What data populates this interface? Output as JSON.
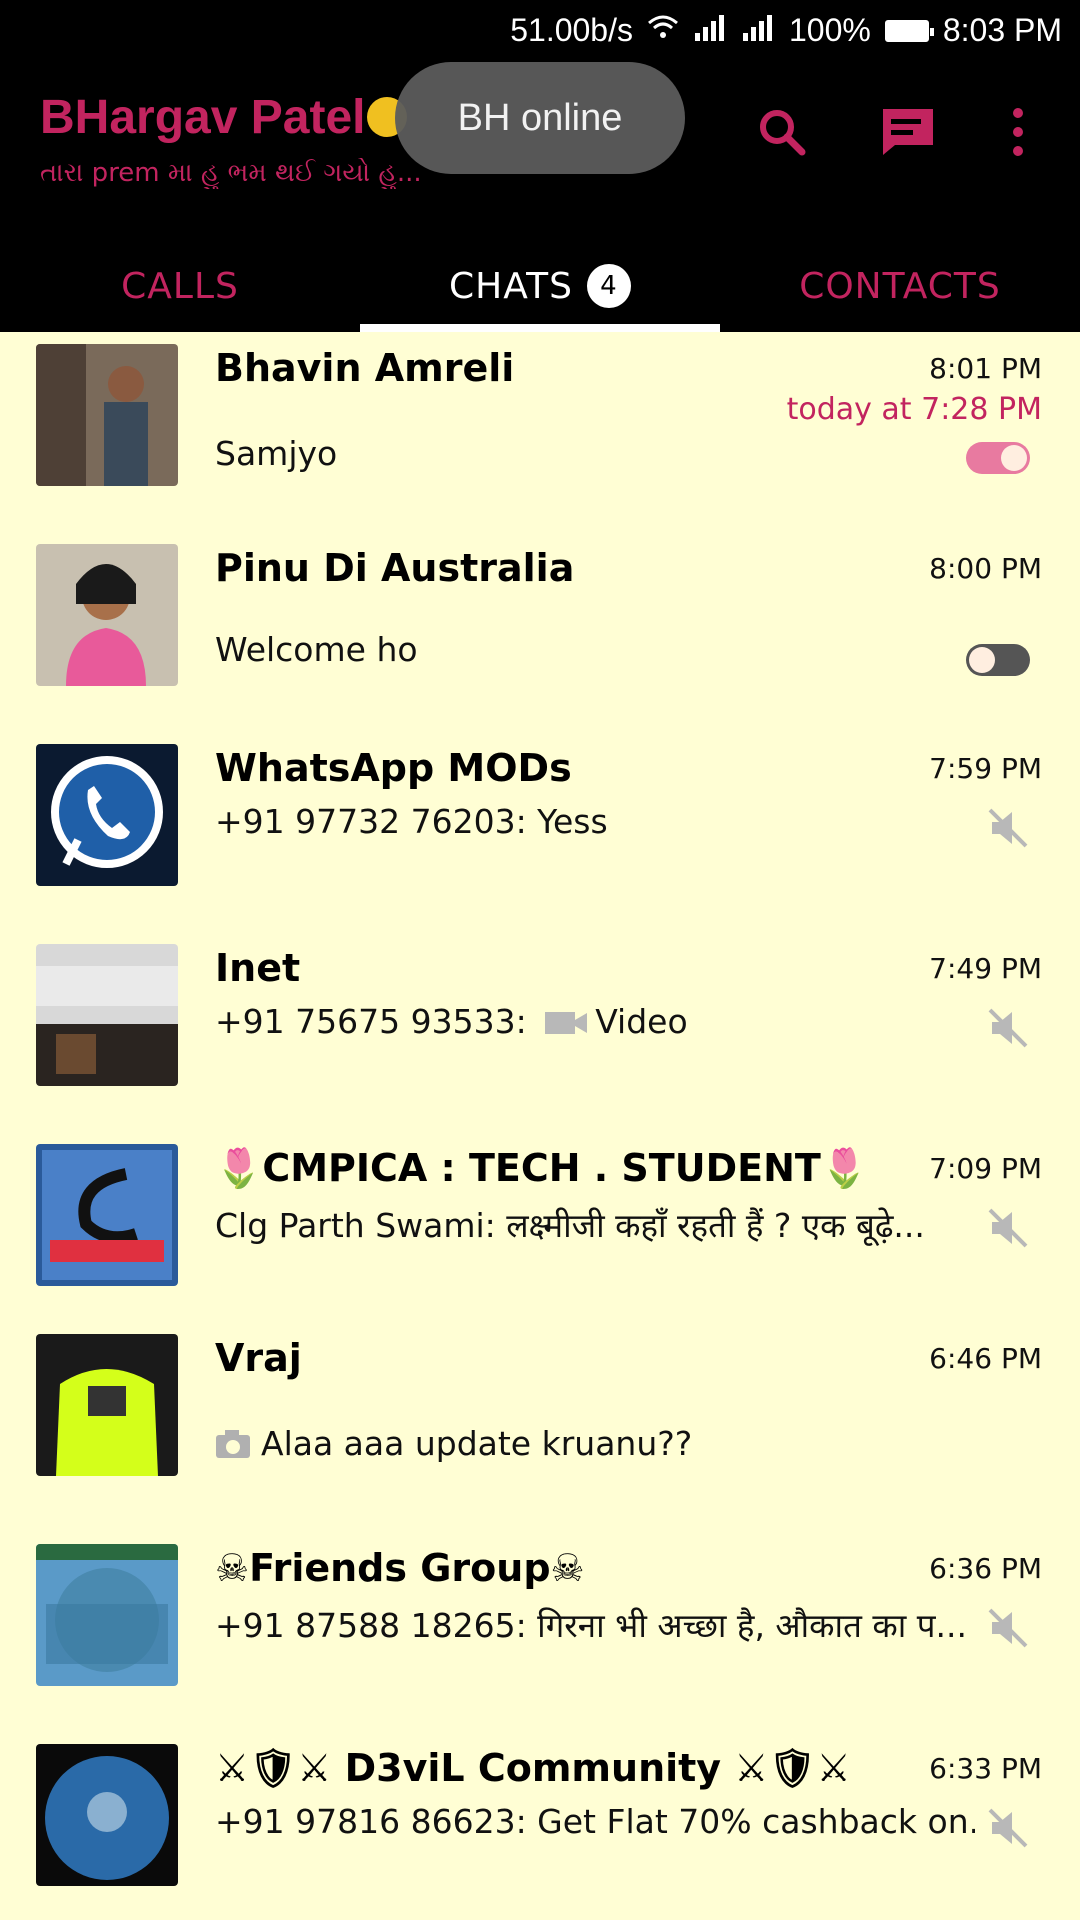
{
  "status_bar": {
    "speed": "51.00b/s",
    "battery": "100%",
    "time": "8:03 PM"
  },
  "header": {
    "title": "BHargav Patel",
    "subtitle": "તારા prem મા હુ ભમ થઈ ગયો હુ...",
    "toast": "BH online"
  },
  "tabs": [
    {
      "label": "CALLS"
    },
    {
      "label": "CHATS",
      "badge": "4"
    },
    {
      "label": "CONTACTS"
    }
  ],
  "chats": [
    {
      "name": "Bhavin Amreli",
      "time": "8:01 PM",
      "sub_time": "today at 7:28 PM",
      "message": "Samjyo"
    },
    {
      "name": "Pinu Di Australia",
      "time": "8:00 PM",
      "message": "Welcome ho"
    },
    {
      "name": "WhatsApp MODs",
      "time": "7:59 PM",
      "message": "+91 97732 76203: Yess"
    },
    {
      "name": "Inet",
      "time": "7:49 PM",
      "message": "+91 75675 93533:",
      "message_extra": "Video"
    },
    {
      "name": "🌷CMPICA : TECH . STUDENT🌷",
      "time": "7:09 PM",
      "message": "Clg Parth Swami: लक्ष्मीजी कहाँ रहती हैं ?  एक बूढ़े..."
    },
    {
      "name": "Vraj",
      "time": "6:46 PM",
      "message": "Alaa aaa update kruanu??"
    },
    {
      "name": "☠Friends Group☠",
      "time": "6:36 PM",
      "message": "+91 87588 18265: गिरना भी अच्छा है, औकात का प..."
    },
    {
      "name": "⚔🛡⚔ D3viL Community ⚔🛡⚔",
      "time": "6:33 PM",
      "message": "+91 97816 86623: Get Flat 70% cashback on..."
    }
  ],
  "colors": {
    "accent": "#c2245f",
    "background": "#fffed4",
    "header_bg": "#000000"
  },
  "icons": [
    "wifi-icon",
    "signal-icon",
    "battery-icon",
    "search-icon",
    "new-chat-icon",
    "more-icon",
    "mute-icon",
    "video-icon",
    "camera-icon"
  ]
}
